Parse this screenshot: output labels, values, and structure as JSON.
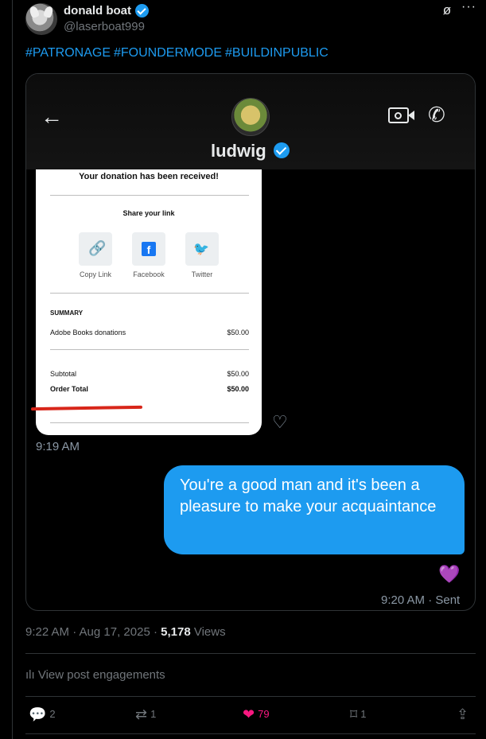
{
  "author": {
    "name": "donald boat",
    "handle": "@laserboat999"
  },
  "hashtags": [
    "#PATRONAGE",
    "#FOUNDERMODE",
    "#BUILDINPUBLIC"
  ],
  "media": {
    "chat_header": {
      "name": "ludwig"
    },
    "receipt": {
      "title": "Your donation has been received!",
      "share_heading": "Share your link",
      "share_options": [
        "Copy Link",
        "Facebook",
        "Twitter"
      ],
      "summary_label": "SUMMARY",
      "line_item": {
        "label": "Adobe Books donations",
        "amount": "$50.00"
      },
      "subtotal": {
        "label": "Subtotal",
        "amount": "$50.00"
      },
      "order_total": {
        "label": "Order Total",
        "amount": "$50.00"
      }
    },
    "received_time": "9:19 AM",
    "sent_message": "You're a good man and it's been a pleasure to make your acquaintance",
    "reaction": "💜",
    "sent_status": "9:20 AM · Sent"
  },
  "post_meta": {
    "time": "9:22 AM · Aug 17, 2025 · ",
    "views_count": "5,178",
    "views_label": " Views"
  },
  "engagements_link": "View post engagements",
  "actions": {
    "replies": "2",
    "reposts": "1",
    "likes": "79",
    "bookmarks": "1"
  },
  "colors": {
    "accent": "#1d9bf0",
    "like": "#f91880",
    "background": "#000000"
  }
}
